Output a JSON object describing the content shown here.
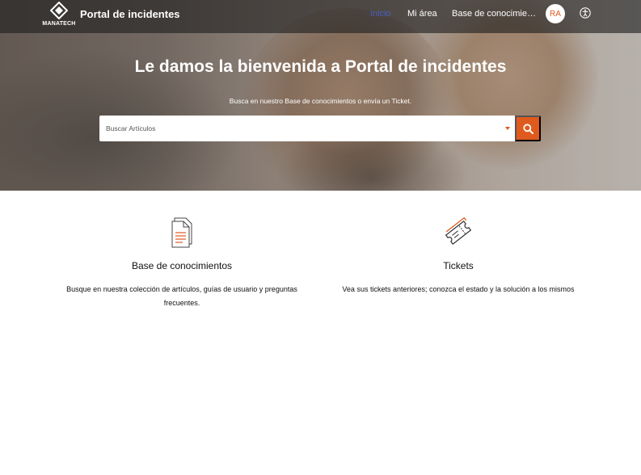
{
  "header": {
    "logo_text": "MANATECH",
    "title": "Portal de incidentes",
    "nav": {
      "home": "Inicio",
      "my_area": "Mi área",
      "knowledge_base": "Base de conocimientos"
    },
    "avatar_initials": "RA"
  },
  "hero": {
    "title": "Le damos la bienvenida a Portal de incidentes",
    "subtitle": "Busca en nuestro Base de conocimientos o envía un Ticket.",
    "search_placeholder": "Buscar Artículos"
  },
  "cards": [
    {
      "icon": "document-icon",
      "title": "Base de conocimientos",
      "description": "Busque en nuestra colección de artículos, guías de usuario y preguntas frecuentes."
    },
    {
      "icon": "ticket-icon",
      "title": "Tickets",
      "description": "Vea sus tickets anteriores; conozca el estado y la solución a los mismos"
    }
  ],
  "colors": {
    "accent": "#e05a1d",
    "nav_active": "#4a5ec4"
  }
}
